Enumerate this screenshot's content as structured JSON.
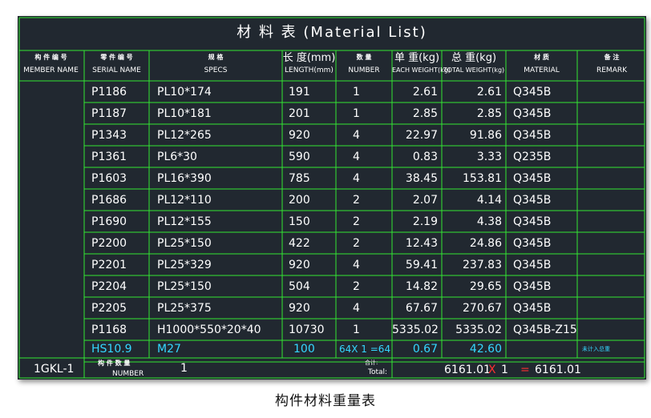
{
  "title": "材    料    表    (Material   List)",
  "headers": [
    {
      "cn": "构 件 编 号",
      "en": "MEMBER NAME"
    },
    {
      "cn": "零 件 编 号",
      "en": "SERIAL NAME"
    },
    {
      "cn": "规 格",
      "en": "SPECS"
    },
    {
      "cn": "长 度(mm)",
      "en": "LENGTH(mm)"
    },
    {
      "cn": "数   量",
      "en": "NUMBER"
    },
    {
      "cn": "单 重(kg)",
      "en": "EACH WEIGHT(kg)"
    },
    {
      "cn": "总 重(kg)",
      "en": "TOTAL WEIGHT(kg)"
    },
    {
      "cn": "材 质",
      "en": "MATERIAL"
    },
    {
      "cn": "备 注",
      "en": "REMARK"
    }
  ],
  "rows": [
    {
      "serial": "P1186",
      "spec": "PL10*174",
      "length": "191",
      "number": "1",
      "each": "2.61",
      "total": "2.61",
      "material": "Q345B"
    },
    {
      "serial": "P1187",
      "spec": "PL10*181",
      "length": "201",
      "number": "1",
      "each": "2.85",
      "total": "2.85",
      "material": "Q345B"
    },
    {
      "serial": "P1343",
      "spec": "PL12*265",
      "length": "920",
      "number": "4",
      "each": "22.97",
      "total": "91.86",
      "material": "Q345B"
    },
    {
      "serial": "P1361",
      "spec": "PL6*30",
      "length": "590",
      "number": "4",
      "each": "0.83",
      "total": "3.33",
      "material": "Q235B"
    },
    {
      "serial": "P1603",
      "spec": "PL16*390",
      "length": "785",
      "number": "4",
      "each": "38.45",
      "total": "153.81",
      "material": "Q345B"
    },
    {
      "serial": "P1686",
      "spec": "PL12*110",
      "length": "200",
      "number": "2",
      "each": "2.07",
      "total": "4.14",
      "material": "Q345B"
    },
    {
      "serial": "P1690",
      "spec": "PL12*155",
      "length": "150",
      "number": "2",
      "each": "2.19",
      "total": "4.38",
      "material": "Q345B"
    },
    {
      "serial": "P2200",
      "spec": "PL25*150",
      "length": "422",
      "number": "2",
      "each": "12.43",
      "total": "24.86",
      "material": "Q345B"
    },
    {
      "serial": "P2201",
      "spec": "PL25*329",
      "length": "920",
      "number": "4",
      "each": "59.41",
      "total": "237.83",
      "material": "Q345B"
    },
    {
      "serial": "P2204",
      "spec": "PL25*150",
      "length": "504",
      "number": "2",
      "each": "14.82",
      "total": "29.65",
      "material": "Q345B"
    },
    {
      "serial": "P2205",
      "spec": "PL25*375",
      "length": "920",
      "number": "4",
      "each": "67.67",
      "total": "270.67",
      "material": "Q345B"
    },
    {
      "serial": "P1168",
      "spec": "H1000*550*20*40",
      "length": "10730",
      "number": "1",
      "each": "5335.02",
      "total": "5335.02",
      "material": "Q345B-Z15"
    }
  ],
  "bolt_row": {
    "serial": "HS10.9",
    "spec": "M27",
    "length": "100",
    "number": "64X 1 =64",
    "each": "0.67",
    "total": "42.60",
    "remark": "未计入总重"
  },
  "footer": {
    "member": "1GKL-1",
    "number_cn": "构 件 数 量",
    "number_en": "NUMBER",
    "number_value": "1",
    "total_cn": "合计:",
    "total_en": "Total:",
    "sum": "6161.01",
    "times": "X",
    "count": "1",
    "equals": "=",
    "grand_total": "6161.01"
  },
  "caption": "构件材料重量表",
  "colors": {
    "background": "#212830",
    "grid": "#32e632",
    "text": "#ffffff",
    "cyan": "#35d7ff",
    "red": "#ff3030"
  }
}
